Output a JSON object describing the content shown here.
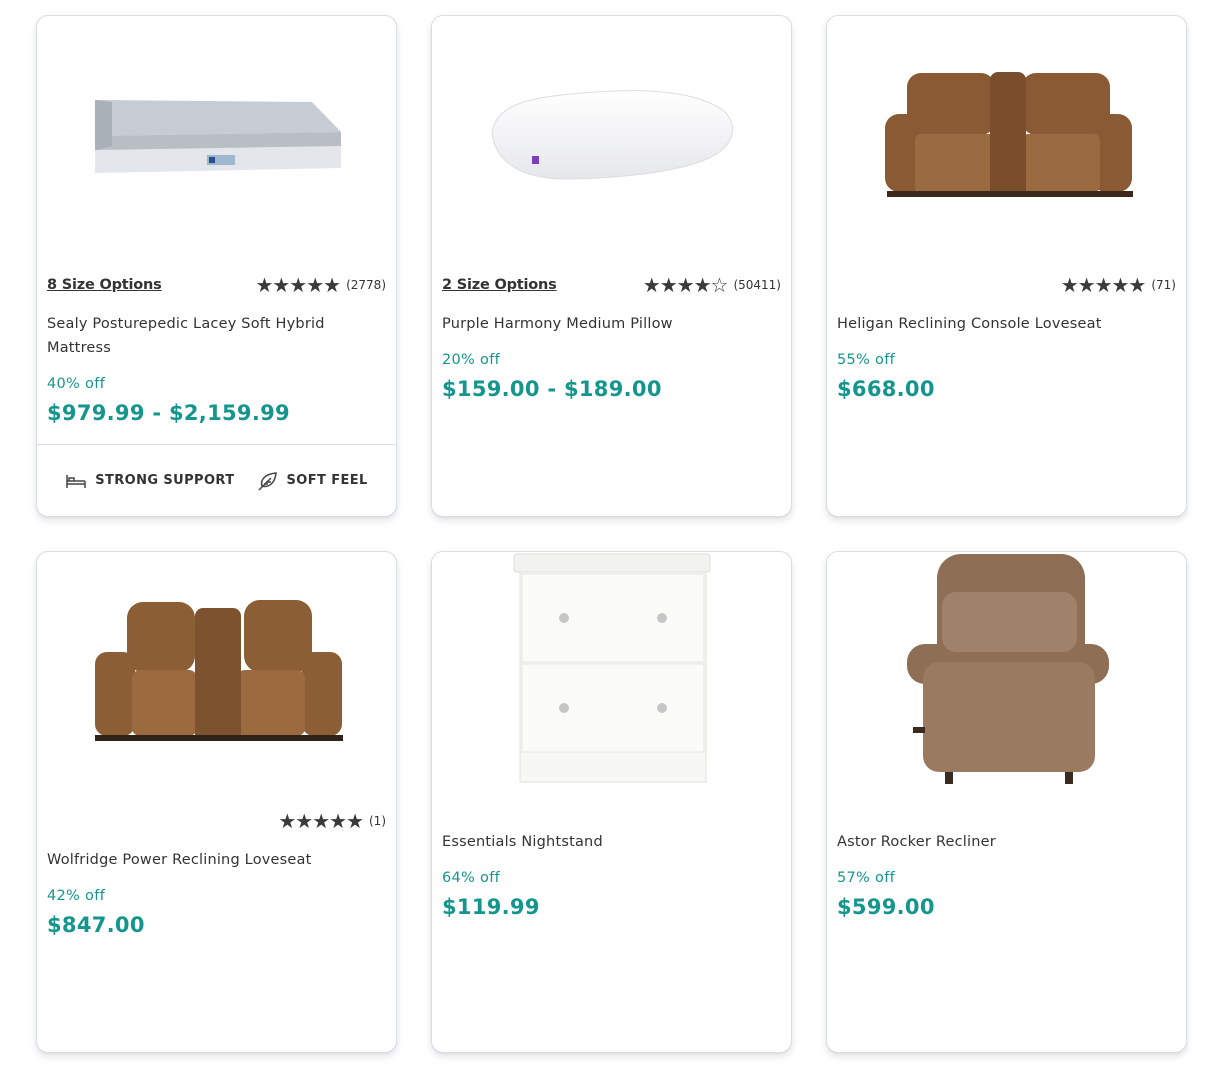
{
  "products": [
    {
      "size_options": "8 Size Options",
      "stars": "★★★★★",
      "rating_count": "(2778)",
      "name": "Sealy Posturepedic Lacey Soft Hybrid Mattress",
      "discount": "40% off",
      "price": "$979.99 - $2,159.99",
      "features": [
        {
          "icon": "bed-icon",
          "label": "STRONG SUPPORT"
        },
        {
          "icon": "feather-icon",
          "label": "SOFT FEEL"
        }
      ]
    },
    {
      "size_options": "2 Size Options",
      "stars": "★★★★☆",
      "rating_count": "(50411)",
      "name": "Purple Harmony Medium Pillow",
      "discount": "20% off",
      "price": "$159.00 - $189.00"
    },
    {
      "stars": "★★★★★",
      "rating_count": "(71)",
      "name": "Heligan Reclining Console Loveseat",
      "discount": "55% off",
      "price": "$668.00"
    },
    {
      "stars": "★★★★★",
      "rating_count": "(1)",
      "name": "Wolfridge Power Reclining Loveseat",
      "discount": "42% off",
      "price": "$847.00"
    },
    {
      "name": "Essentials Nightstand",
      "discount": "64% off",
      "price": "$119.99"
    },
    {
      "name": "Astor Rocker Recliner",
      "discount": "57% off",
      "price": "$599.00"
    }
  ],
  "colors": {
    "accent": "#14968e",
    "text": "#333333",
    "border": "#d9dee3"
  }
}
